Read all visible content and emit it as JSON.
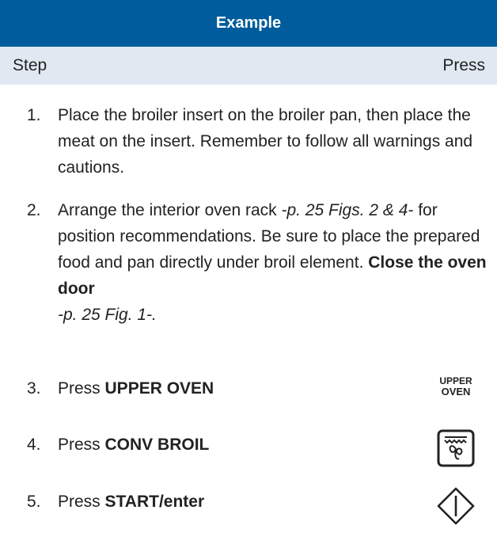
{
  "header": {
    "title": "Example"
  },
  "columns": {
    "step": "Step",
    "press": "Press"
  },
  "steps": [
    {
      "num": "1.",
      "text": "Place the broiler insert on the broiler pan, then place the meat on the insert. Remember to follow all warnings and cautions."
    },
    {
      "num": "2.",
      "a": "Arrange the interior oven rack ",
      "ref1": "-p. 25 Figs. 2 & 4-",
      "b": " for position recommendations. Be sure to place the prepared food and pan directly under broil element. ",
      "bold": "Close the oven door",
      "ref2": "-p. 25 Fig. 1-."
    },
    {
      "num": "3.",
      "pre": "Press ",
      "bold": "UPPER OVEN"
    },
    {
      "num": "4.",
      "pre": "Press ",
      "bold": "CONV BROIL"
    },
    {
      "num": "5.",
      "pre": "Press ",
      "bold": "START/enter"
    }
  ],
  "icons": {
    "upper_oven_line1": "UPPER",
    "upper_oven_line2": "OVEN",
    "conv_broil": "conv-broil-icon",
    "start": "start-icon"
  },
  "colors": {
    "header_bg": "#005c9c",
    "subheader_bg": "#e0e9f2",
    "text": "#222222"
  }
}
